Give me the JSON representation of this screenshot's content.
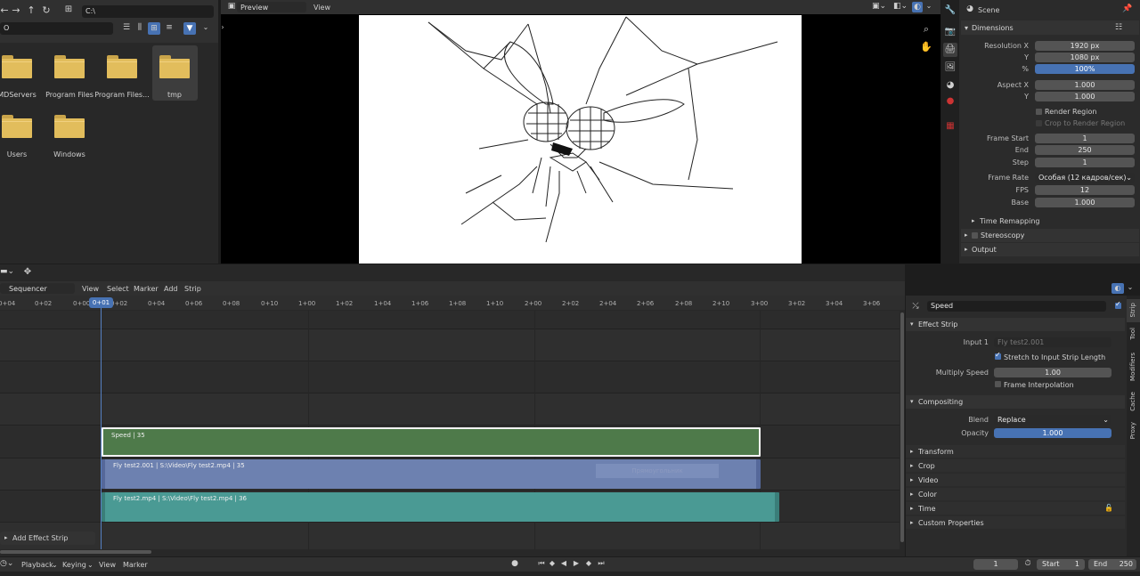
{
  "file_browser": {
    "path": "C:\\",
    "search_placeholder": "",
    "folders": [
      {
        "label": "MDServers"
      },
      {
        "label": "Program Files"
      },
      {
        "label": "Program Files..."
      },
      {
        "label": "tmp"
      },
      {
        "label": "Users"
      },
      {
        "label": "Windows"
      }
    ]
  },
  "preview": {
    "mode": "Preview",
    "view_menu": "View"
  },
  "properties": {
    "scene_label": "Scene",
    "dimensions_title": "Dimensions",
    "resolution_x_label": "Resolution X",
    "resolution_x": "1920 px",
    "y_label": "Y",
    "resolution_y": "1080 px",
    "percent_label": "%",
    "percent": "100%",
    "aspect_x_label": "Aspect X",
    "aspect_x": "1.000",
    "aspect_y": "1.000",
    "render_region": "Render Region",
    "crop_region": "Crop to Render Region",
    "frame_start_label": "Frame Start",
    "frame_start": "1",
    "end_label": "End",
    "frame_end": "250",
    "step_label": "Step",
    "frame_step": "1",
    "frame_rate_label": "Frame Rate",
    "frame_rate": "Особая (12 кадров/сек)",
    "fps_label": "FPS",
    "fps": "12",
    "base_label": "Base",
    "base": "1.000",
    "time_remapping": "Time Remapping",
    "stereoscopy": "Stereoscopy",
    "output": "Output"
  },
  "sequencer": {
    "editor": "Sequencer",
    "menus": [
      "View",
      "Select",
      "Marker",
      "Add",
      "Strip"
    ],
    "current_frame": "0+01",
    "ticks": [
      "0+04",
      "0+02",
      "0+00",
      "0+02",
      "0+04",
      "0+06",
      "0+08",
      "0+10",
      "1+00",
      "1+02",
      "1+04",
      "1+06",
      "1+08",
      "1+10",
      "2+00",
      "2+02",
      "2+04",
      "2+06",
      "2+08",
      "2+10",
      "3+00",
      "3+02",
      "3+04",
      "3+06"
    ],
    "strips": [
      {
        "label": "Speed | 35"
      },
      {
        "label": "Fly test2.001 | S:\\Video\\Fly test2.mp4 | 35"
      },
      {
        "label": "Fly test2.mp4 | S:\\Video\\Fly test2.mp4 | 36"
      }
    ],
    "overlay_text": "Прямоугольник",
    "add_effect_strip": "Add Effect Strip"
  },
  "strip_panel": {
    "name": "Speed",
    "effect_strip_title": "Effect Strip",
    "input1_label": "Input 1",
    "input1": "Fly test2.001",
    "stretch_label": "Stretch to Input Strip Length",
    "multiply_speed_label": "Multiply Speed",
    "multiply_speed": "1.00",
    "frame_interp_label": "Frame Interpolation",
    "compositing_title": "Compositing",
    "blend_label": "Blend",
    "blend": "Replace",
    "opacity_label": "Opacity",
    "opacity": "1.000",
    "sections": [
      "Transform",
      "Crop",
      "Video",
      "Color",
      "Time",
      "Custom Properties"
    ],
    "tabs": [
      "Strip",
      "Tool",
      "Modifiers",
      "Cache",
      "Proxy"
    ]
  },
  "timeline_footer": {
    "menus": [
      "Playback",
      "Keying",
      "View",
      "Marker"
    ],
    "frame": "1",
    "start_label": "Start",
    "start": "1",
    "end_label": "End",
    "end": "250"
  }
}
